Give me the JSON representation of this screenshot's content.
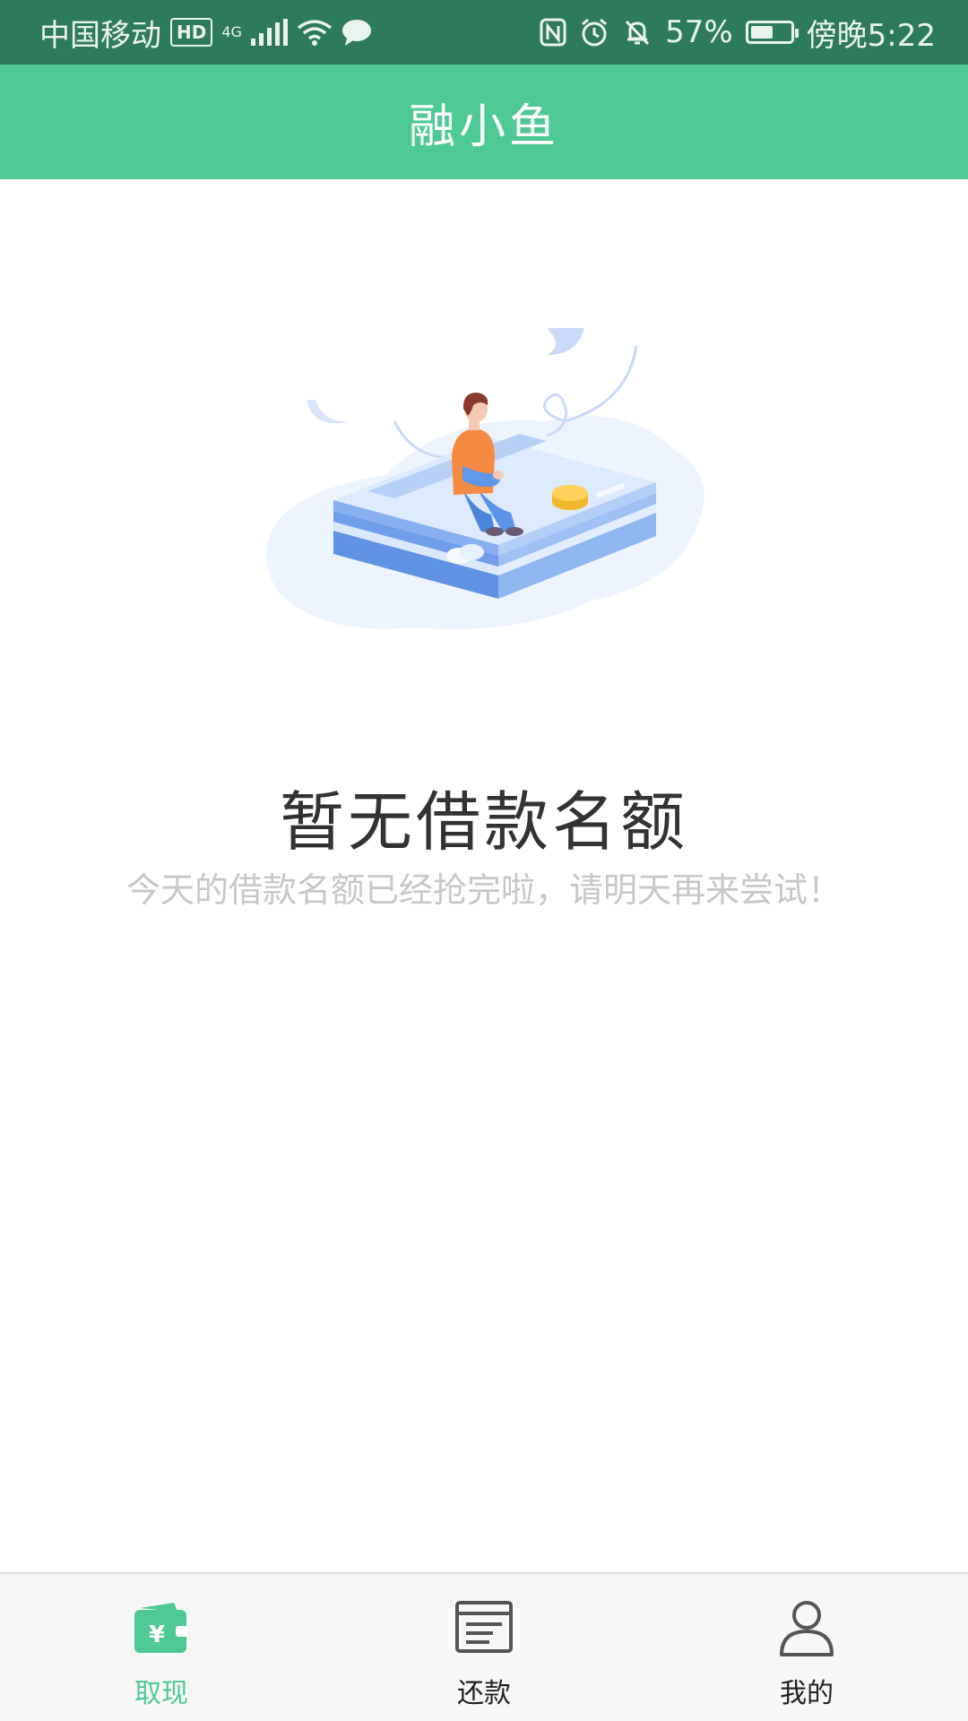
{
  "status_bar": {
    "carrier": "中国移动",
    "hd_badge": "HD",
    "network": "4G",
    "battery_percent": "57%",
    "time": "傍晚5:22",
    "battery_level": 0.57
  },
  "app_bar": {
    "title": "融小鱼"
  },
  "empty_state": {
    "title": "暂无借款名额",
    "subtitle": "今天的借款名额已经抢完啦，请明天再来尝试！"
  },
  "bottom_nav": {
    "items": [
      {
        "label": "取现",
        "icon": "wallet-yen-icon",
        "active": true
      },
      {
        "label": "还款",
        "icon": "document-icon",
        "active": false
      },
      {
        "label": "我的",
        "icon": "user-icon",
        "active": false
      }
    ]
  },
  "colors": {
    "accent": "#4ec996",
    "status_bar_bg": "#2e7a5c",
    "title_text": "#333333",
    "subtitle_text": "#c8c8c8"
  }
}
